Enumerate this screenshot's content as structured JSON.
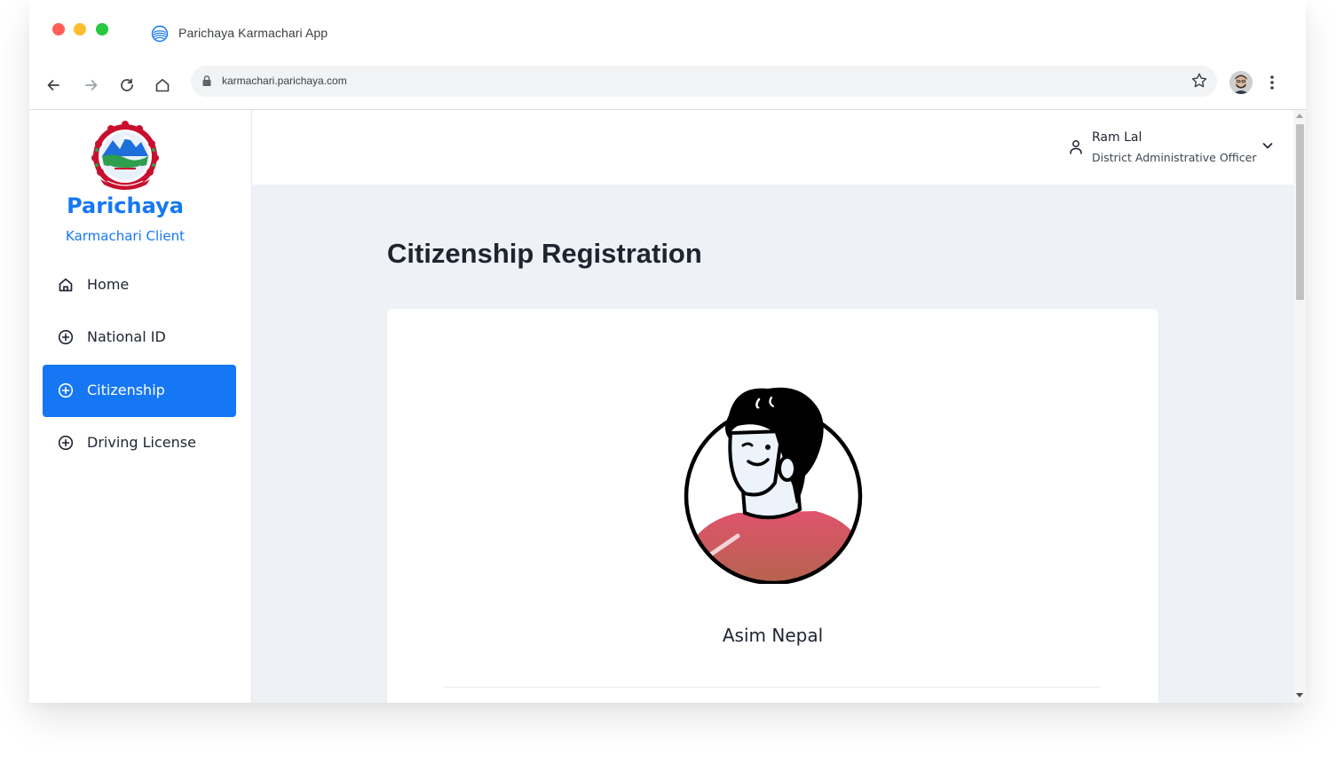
{
  "browser": {
    "tab_title": "Parichaya Karmachari App",
    "url": "karmachari.parichaya.com",
    "icons": {
      "tab": "globe-waves-icon",
      "back": "arrow-left-icon",
      "forward": "arrow-right-icon",
      "reload": "reload-icon",
      "home": "home-icon",
      "lock": "lock-icon",
      "bookmark": "star-icon",
      "profile": "avatar",
      "menu": "kebab-menu-icon"
    }
  },
  "sidebar": {
    "brand_title": "Parichaya",
    "brand_subtitle": "Karmachari Client",
    "accent_color": "#1677f5",
    "items": [
      {
        "label": "Home",
        "icon": "home-icon",
        "active": false
      },
      {
        "label": "National ID",
        "icon": "plus-circle-icon",
        "active": false
      },
      {
        "label": "Citizenship",
        "icon": "plus-circle-icon",
        "active": true
      },
      {
        "label": "Driving License",
        "icon": "plus-circle-icon",
        "active": false
      }
    ]
  },
  "header": {
    "user_name": "Ram Lal",
    "user_role": "District Administrative Officer"
  },
  "main": {
    "page_title": "Citizenship Registration",
    "profile_name": "Asim Nepal"
  }
}
